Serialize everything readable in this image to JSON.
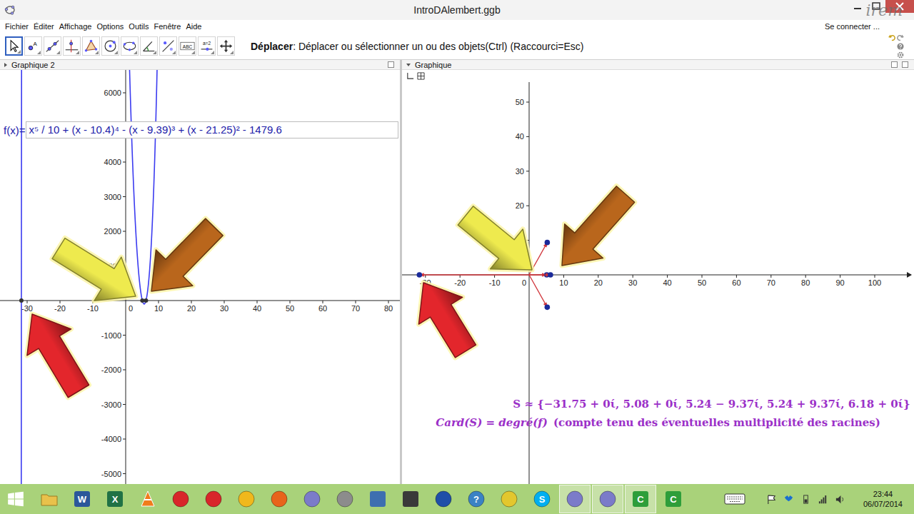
{
  "window": {
    "title": "IntroDAlembert.ggb",
    "watermark": "irem"
  },
  "menu": {
    "items": [
      "Fichier",
      "Éditer",
      "Affichage",
      "Options",
      "Outils",
      "Fenêtre",
      "Aide"
    ],
    "login": "Se connecter ..."
  },
  "toolbar": {
    "tools": [
      {
        "kind": "move",
        "label": "",
        "selected": true
      },
      {
        "kind": "point",
        "label": "A",
        "selected": false
      },
      {
        "kind": "line",
        "label": "",
        "selected": false
      },
      {
        "kind": "perpendicular",
        "label": "",
        "selected": false
      },
      {
        "kind": "polygon",
        "label": "",
        "selected": false
      },
      {
        "kind": "circle",
        "label": "",
        "selected": false
      },
      {
        "kind": "conic",
        "label": "",
        "selected": false
      },
      {
        "kind": "angle",
        "label": "",
        "selected": false
      },
      {
        "kind": "reflect",
        "label": "",
        "selected": false
      },
      {
        "kind": "text",
        "label": "ABC",
        "selected": false
      },
      {
        "kind": "slider",
        "label": "a=2",
        "selected": false
      },
      {
        "kind": "pan",
        "label": "",
        "selected": false
      }
    ],
    "help": {
      "tool": "Déplacer",
      "text": ": Déplacer ou sélectionner un ou des objets(Ctrl) (Raccourci=Esc)"
    }
  },
  "graphics2": {
    "title": "Graphique 2",
    "input": {
      "label": "f(x)=",
      "value": "x⁵ / 10 + (x - 10.4)⁴ - (x - 9.39)³ + (x - 21.25)² - 1479.6"
    },
    "x_ticks": [
      "-30",
      "-20",
      "-10",
      "0",
      "10",
      "20",
      "30",
      "40",
      "50",
      "60",
      "70",
      "80"
    ],
    "y_ticks": [
      "6000",
      "4000",
      "3000",
      "2000",
      "1000",
      "-1000",
      "-2000",
      "-3000",
      "-4000",
      "-5000"
    ],
    "arrows": [
      {
        "color": "#eeea4e"
      },
      {
        "color": "#b9661c"
      },
      {
        "color": "#e3262c"
      }
    ]
  },
  "graphics": {
    "title": "Graphique",
    "x_ticks": [
      "-30",
      "-20",
      "-10",
      "0",
      "10",
      "20",
      "30",
      "40",
      "50",
      "60",
      "70",
      "80",
      "90",
      "100"
    ],
    "y_ticks": [
      "10",
      "20",
      "30",
      "40",
      "50"
    ],
    "arrows": [
      {
        "color": "#eeea4e"
      },
      {
        "color": "#b9661c"
      },
      {
        "color": "#e3262c"
      }
    ],
    "solution": {
      "set": "S ≈  {−31.75 + 0ί, 5.08 + 0ί, 5.24 − 9.37ί, 5.24 + 9.37ί, 6.18 + 0ί}",
      "formula": "Card(S) = degré(f)",
      "note": "(compte tenu des éventuelles multiplicité des racines)"
    }
  },
  "polynomial": {
    "leading": 0.1,
    "roots": [
      {
        "re": -31.75,
        "im": 0
      },
      {
        "re": 5.08,
        "im": 0
      },
      {
        "re": 5.24,
        "im": -9.37
      },
      {
        "re": 5.24,
        "im": 9.37
      },
      {
        "re": 6.18,
        "im": 0
      }
    ]
  },
  "taskbar": {
    "apps": [
      {
        "kind": "folder",
        "label": "",
        "color": "#e9c14b",
        "active": false
      },
      {
        "kind": "tile",
        "label": "W",
        "color": "#2b579a",
        "active": false
      },
      {
        "kind": "tile",
        "label": "X",
        "color": "#207245",
        "active": false
      },
      {
        "kind": "cone",
        "label": "",
        "color": "#f07c1c",
        "active": false
      },
      {
        "kind": "round",
        "label": "",
        "color": "#d8262a",
        "active": false
      },
      {
        "kind": "round",
        "label": "",
        "color": "#d8262a",
        "active": false
      },
      {
        "kind": "round",
        "label": "",
        "color": "#f0b81c",
        "active": false
      },
      {
        "kind": "round",
        "label": "",
        "color": "#e8641b",
        "active": false
      },
      {
        "kind": "round",
        "label": "",
        "color": "#7b7bc9",
        "active": false
      },
      {
        "kind": "round",
        "label": "",
        "color": "#8c8c8c",
        "active": false
      },
      {
        "kind": "tile",
        "label": "",
        "color": "#3d6fb0",
        "active": false
      },
      {
        "kind": "tile",
        "label": "",
        "color": "#3a3a3a",
        "active": false
      },
      {
        "kind": "round",
        "label": "",
        "color": "#1f4fa8",
        "active": false
      },
      {
        "kind": "round",
        "label": "?",
        "color": "#3b82c4",
        "active": false
      },
      {
        "kind": "round",
        "label": "",
        "color": "#e3c72e",
        "active": false
      },
      {
        "kind": "round",
        "label": "S",
        "color": "#00aff0",
        "active": false
      },
      {
        "kind": "round",
        "label": "",
        "color": "#7b7bc9",
        "active": true
      },
      {
        "kind": "round",
        "label": "",
        "color": "#7b7bc9",
        "active": true
      },
      {
        "kind": "tile",
        "label": "C",
        "color": "#2e9e3a",
        "active": true
      },
      {
        "kind": "tile",
        "label": "C",
        "color": "#2e9e3a",
        "active": false
      }
    ],
    "time": "23:44",
    "date": "06/07/2014"
  }
}
